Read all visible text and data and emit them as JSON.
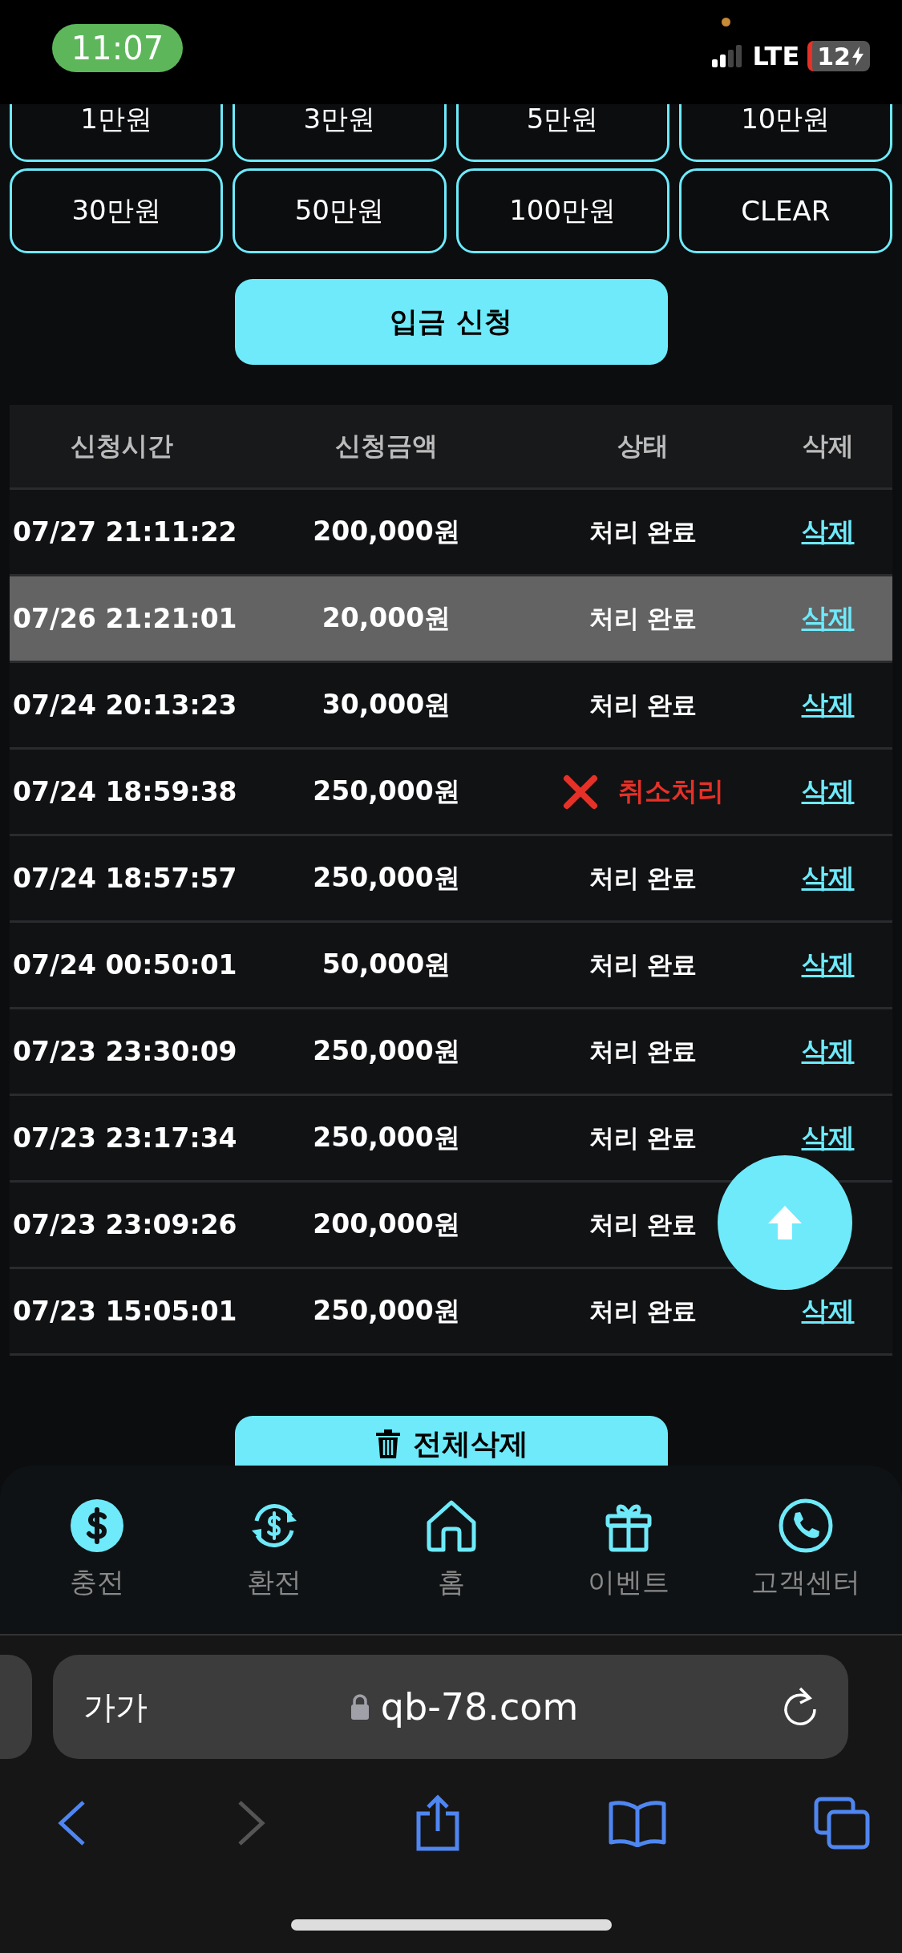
{
  "status_bar": {
    "time": "11:07",
    "network": "LTE",
    "battery": "12"
  },
  "amount_buttons": [
    "1만원",
    "3만원",
    "5만원",
    "10만원",
    "30만원",
    "50만원",
    "100만원",
    "CLEAR"
  ],
  "submit_button": "입금 신청",
  "table": {
    "columns": [
      "신청시간",
      "신청금액",
      "상태",
      "삭제"
    ],
    "rows": [
      {
        "time": "07/27 21:11:22",
        "amount": "200,000원",
        "status": "처리 완료",
        "kind": "done",
        "action": "삭제",
        "selected": false
      },
      {
        "time": "07/26 21:21:01",
        "amount": "20,000원",
        "status": "처리 완료",
        "kind": "done",
        "action": "삭제",
        "selected": true
      },
      {
        "time": "07/24 20:13:23",
        "amount": "30,000원",
        "status": "처리 완료",
        "kind": "done",
        "action": "삭제",
        "selected": false
      },
      {
        "time": "07/24 18:59:38",
        "amount": "250,000원",
        "status": "취소처리",
        "kind": "cancelled",
        "action": "삭제",
        "selected": false
      },
      {
        "time": "07/24 18:57:57",
        "amount": "250,000원",
        "status": "처리 완료",
        "kind": "done",
        "action": "삭제",
        "selected": false
      },
      {
        "time": "07/24 00:50:01",
        "amount": "50,000원",
        "status": "처리 완료",
        "kind": "done",
        "action": "삭제",
        "selected": false
      },
      {
        "time": "07/23 23:30:09",
        "amount": "250,000원",
        "status": "처리 완료",
        "kind": "done",
        "action": "삭제",
        "selected": false
      },
      {
        "time": "07/23 23:17:34",
        "amount": "250,000원",
        "status": "처리 완료",
        "kind": "done",
        "action": "삭제",
        "selected": false
      },
      {
        "time": "07/23 23:09:26",
        "amount": "200,000원",
        "status": "처리 완료",
        "kind": "done",
        "selected": false
      },
      {
        "time": "07/23 15:05:01",
        "amount": "250,000원",
        "status": "처리 완료",
        "kind": "done",
        "action": "삭제",
        "selected": false
      }
    ]
  },
  "delete_all_button": "전체삭제",
  "bottom_nav": [
    {
      "label": "충전",
      "kind": "charge"
    },
    {
      "label": "환전",
      "kind": "exchange"
    },
    {
      "label": "홈",
      "kind": "home"
    },
    {
      "label": "이벤트",
      "kind": "event"
    },
    {
      "label": "고객센터",
      "kind": "support"
    }
  ],
  "browser": {
    "text_size": "가가",
    "url": "qb-78.com"
  }
}
